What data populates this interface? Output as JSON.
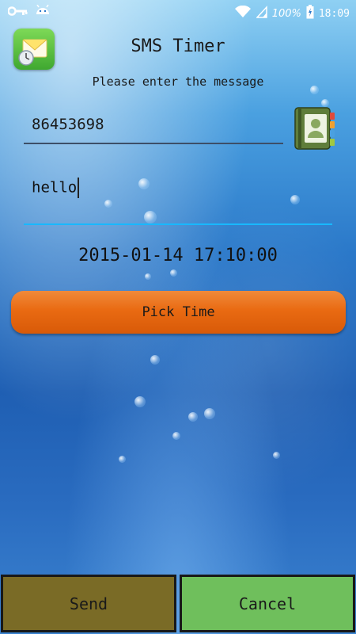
{
  "status_bar": {
    "battery_text": "100%",
    "time": "18:09",
    "icons": [
      "key-icon",
      "android-icon",
      "wifi-icon",
      "signal-icon",
      "battery-icon"
    ]
  },
  "header": {
    "title": "SMS Timer",
    "subtitle": "Please enter the message",
    "app_icon": "sms-envelope-clock-icon"
  },
  "form": {
    "phone_number": "86453698",
    "contacts_icon": "contacts-book-icon",
    "message": "hello",
    "scheduled_datetime": "2015-01-14 17:10:00",
    "pick_time_label": "Pick Time"
  },
  "actions": {
    "send_label": "Send",
    "cancel_label": "Cancel"
  },
  "colors": {
    "pick_time_button": "#e96a12",
    "send_button": "#7a6b26",
    "cancel_button": "#6fbf5c",
    "message_underline": "#18b8ff"
  }
}
